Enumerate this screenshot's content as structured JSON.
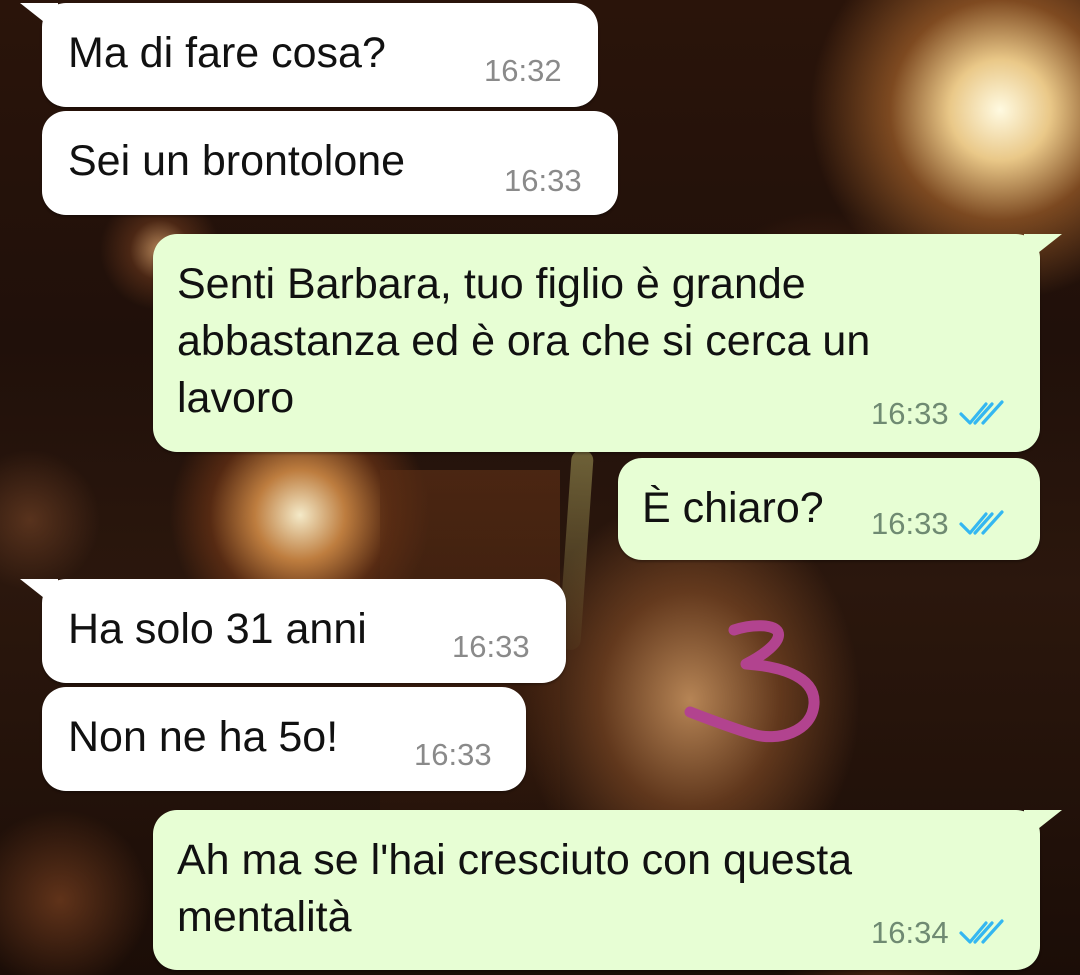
{
  "messages": [
    {
      "direction": "in",
      "text": "Ma di fare cosa?",
      "time": "16:32"
    },
    {
      "direction": "in",
      "text": "Sei un brontolone",
      "time": "16:33"
    },
    {
      "direction": "out",
      "lines": [
        "Senti Barbara, tuo figlio è grande",
        "abbastanza ed è ora che si cerca un",
        "lavoro"
      ],
      "time": "16:33",
      "status": "read"
    },
    {
      "direction": "out",
      "text": "È chiaro?",
      "time": "16:33",
      "status": "read"
    },
    {
      "direction": "in",
      "text": "Ha solo 31 anni",
      "time": "16:33"
    },
    {
      "direction": "in",
      "text": "Non ne ha 5o!",
      "time": "16:33"
    },
    {
      "direction": "out",
      "lines": [
        "Ah ma se l'hai cresciuto con questa",
        "mentalità"
      ],
      "time": "16:34",
      "status": "read"
    }
  ],
  "annotation": {
    "text": "3",
    "color": "#b2438f"
  },
  "icons": {
    "read_receipt": "double-check-icon",
    "read_color": "#34b7f1"
  },
  "colors": {
    "incoming_bubble": "#ffffff",
    "outgoing_bubble": "#e7fed4"
  }
}
